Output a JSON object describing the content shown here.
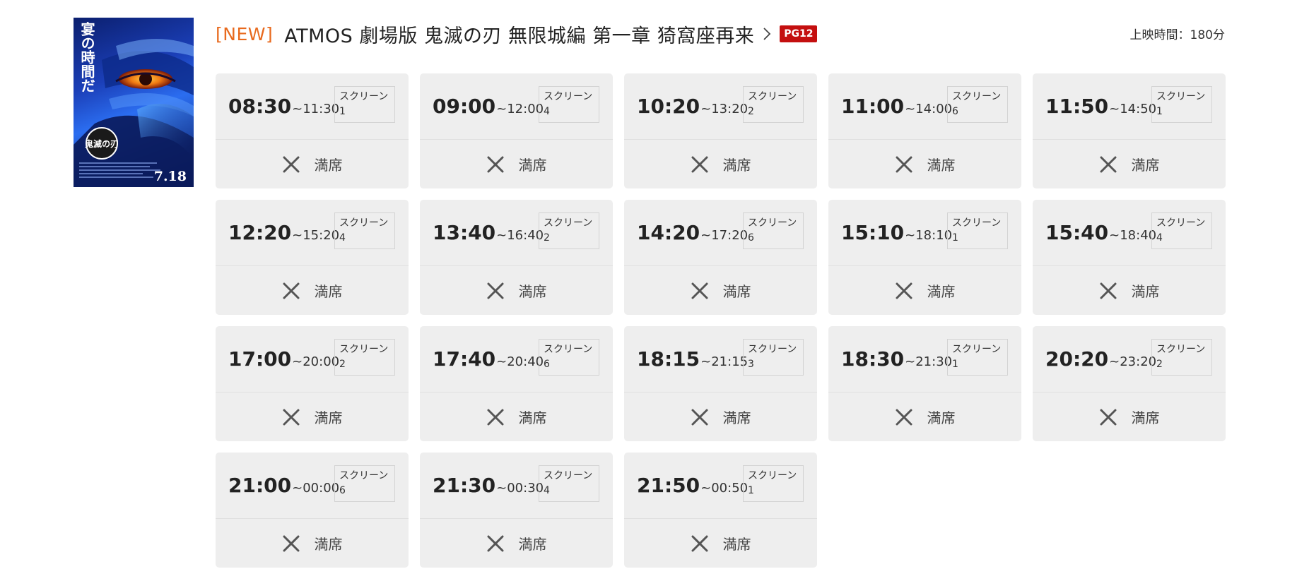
{
  "poster": {
    "icon": "movie-poster",
    "text": "宴の時間だ",
    "date": "7.18",
    "logo_text": "鬼滅の刃"
  },
  "header": {
    "new_label": "[NEW]",
    "title": "ATMOS 劇場版 鬼滅の刃 無限城編 第一章 猗窩座再来",
    "rating": "PG12",
    "runtime": "上映時間：180分",
    "colors": {
      "new": "#e86a1e",
      "rating_bg": "#c40f0f"
    }
  },
  "showtimes": [
    {
      "start": "08:30",
      "end": "~11:30",
      "screen_label": "スクリーン",
      "screen": "1",
      "status": "満席"
    },
    {
      "start": "09:00",
      "end": "~12:00",
      "screen_label": "スクリーン",
      "screen": "4",
      "status": "満席"
    },
    {
      "start": "10:20",
      "end": "~13:20",
      "screen_label": "スクリーン",
      "screen": "2",
      "status": "満席"
    },
    {
      "start": "11:00",
      "end": "~14:00",
      "screen_label": "スクリーン",
      "screen": "6",
      "status": "満席"
    },
    {
      "start": "11:50",
      "end": "~14:50",
      "screen_label": "スクリーン",
      "screen": "1",
      "status": "満席"
    },
    {
      "start": "12:20",
      "end": "~15:20",
      "screen_label": "スクリーン",
      "screen": "4",
      "status": "満席"
    },
    {
      "start": "13:40",
      "end": "~16:40",
      "screen_label": "スクリーン",
      "screen": "2",
      "status": "満席"
    },
    {
      "start": "14:20",
      "end": "~17:20",
      "screen_label": "スクリーン",
      "screen": "6",
      "status": "満席"
    },
    {
      "start": "15:10",
      "end": "~18:10",
      "screen_label": "スクリーン",
      "screen": "1",
      "status": "満席"
    },
    {
      "start": "15:40",
      "end": "~18:40",
      "screen_label": "スクリーン",
      "screen": "4",
      "status": "満席"
    },
    {
      "start": "17:00",
      "end": "~20:00",
      "screen_label": "スクリーン",
      "screen": "2",
      "status": "満席"
    },
    {
      "start": "17:40",
      "end": "~20:40",
      "screen_label": "スクリーン",
      "screen": "6",
      "status": "満席"
    },
    {
      "start": "18:15",
      "end": "~21:15",
      "screen_label": "スクリーン",
      "screen": "3",
      "status": "満席"
    },
    {
      "start": "18:30",
      "end": "~21:30",
      "screen_label": "スクリーン",
      "screen": "1",
      "status": "満席"
    },
    {
      "start": "20:20",
      "end": "~23:20",
      "screen_label": "スクリーン",
      "screen": "2",
      "status": "満席"
    },
    {
      "start": "21:00",
      "end": "~00:00",
      "screen_label": "スクリーン",
      "screen": "6",
      "status": "満席"
    },
    {
      "start": "21:30",
      "end": "~00:30",
      "screen_label": "スクリーン",
      "screen": "4",
      "status": "満席"
    },
    {
      "start": "21:50",
      "end": "~00:50",
      "screen_label": "スクリーン",
      "screen": "1",
      "status": "満席"
    }
  ],
  "status_icon": "close-x-icon"
}
